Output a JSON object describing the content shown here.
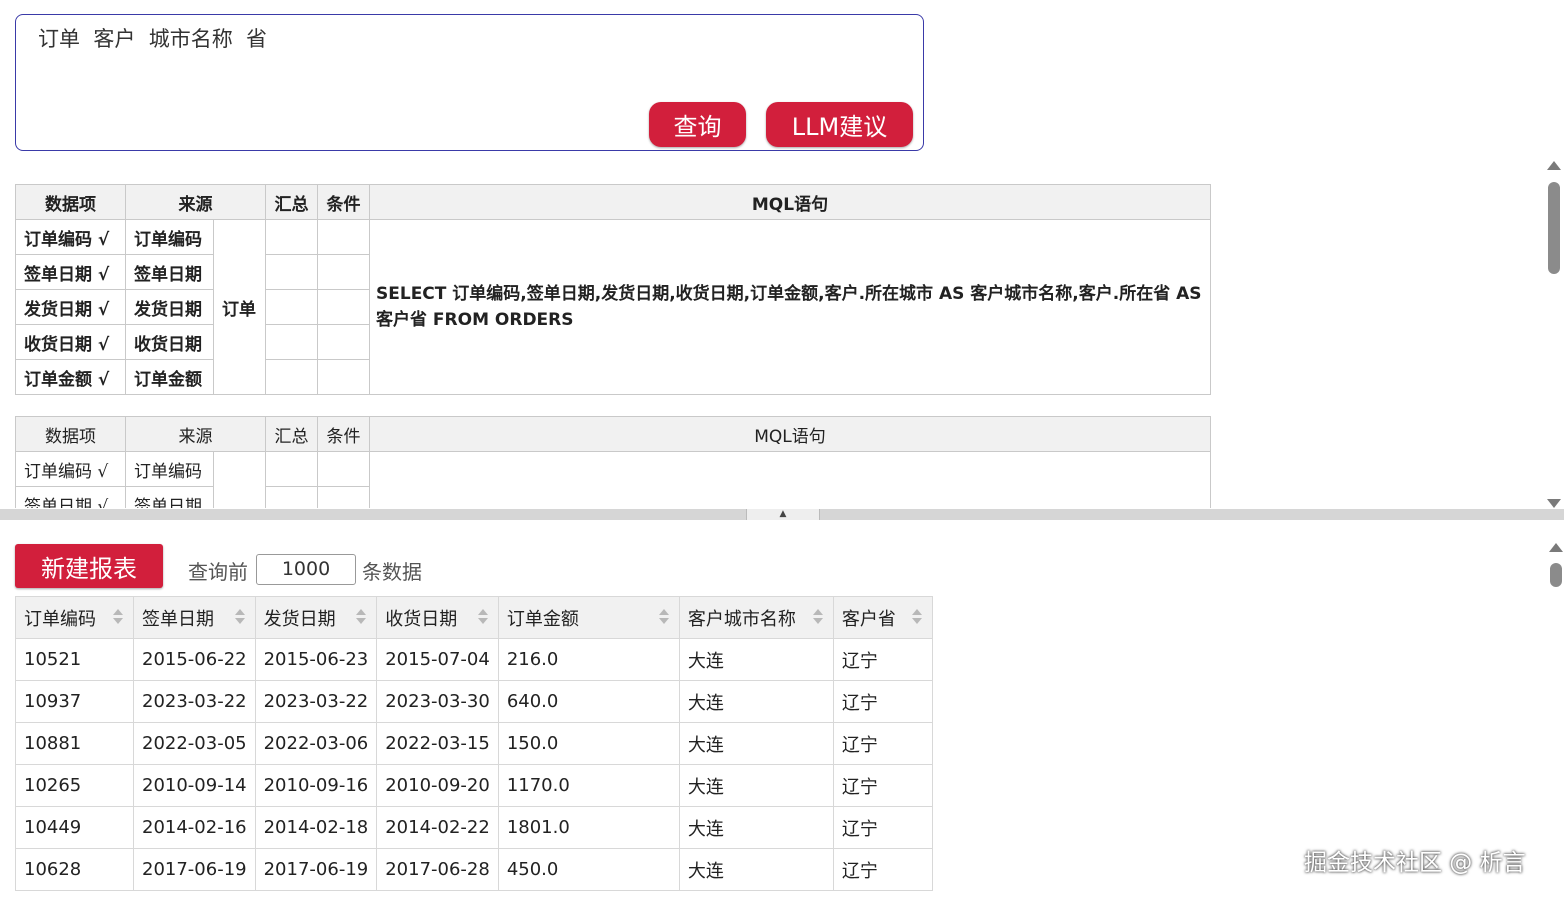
{
  "query": {
    "text": "订单  客户  城市名称  省",
    "query_button": "查询",
    "llm_button": "LLM建议"
  },
  "mql_panel_1": {
    "headers": [
      "数据项",
      "来源",
      "汇总",
      "条件",
      "MQL语句"
    ],
    "items": [
      "订单编码 √",
      "签单日期 √",
      "发货日期 √",
      "收货日期 √",
      "订单金额 √"
    ],
    "sources": [
      "订单编码",
      "签单日期",
      "发货日期",
      "收货日期",
      "订单金额"
    ],
    "table_name": "订单",
    "sql": "SELECT 订单编码,签单日期,发货日期,收货日期,订单金额,客户.所在城市 AS 客户城市名称,客户.所在省 AS 客户省 FROM ORDERS"
  },
  "mql_panel_2": {
    "headers": [
      "数据项",
      "来源",
      "汇总",
      "条件",
      "MQL语句"
    ],
    "items": [
      "订单编码 √",
      "签单日期 √"
    ],
    "sources": [
      "订单编码",
      "签单日期"
    ]
  },
  "toolbar": {
    "new_report": "新建报表",
    "limit_prefix": "查询前",
    "limit_value": "1000",
    "limit_suffix": "条数据"
  },
  "results": {
    "columns": [
      "订单编码",
      "签单日期",
      "发货日期",
      "收货日期",
      "订单金额",
      "客户城市名称",
      "客户省"
    ],
    "rows": [
      [
        "10521",
        "2015-06-22",
        "2015-06-23",
        "2015-07-04",
        "216.0",
        "大连",
        "辽宁"
      ],
      [
        "10937",
        "2023-03-22",
        "2023-03-22",
        "2023-03-30",
        "640.0",
        "大连",
        "辽宁"
      ],
      [
        "10881",
        "2022-03-05",
        "2022-03-06",
        "2022-03-15",
        "150.0",
        "大连",
        "辽宁"
      ],
      [
        "10265",
        "2010-09-14",
        "2010-09-16",
        "2010-09-20",
        "1170.0",
        "大连",
        "辽宁"
      ],
      [
        "10449",
        "2014-02-16",
        "2014-02-18",
        "2014-02-22",
        "1801.0",
        "大连",
        "辽宁"
      ],
      [
        "10628",
        "2017-06-19",
        "2017-06-19",
        "2017-06-28",
        "450.0",
        "大连",
        "辽宁"
      ]
    ]
  },
  "watermark": "掘金技术社区 @ 析言",
  "colors": {
    "accent": "#d21f3c",
    "border": "#3a3aa8"
  }
}
